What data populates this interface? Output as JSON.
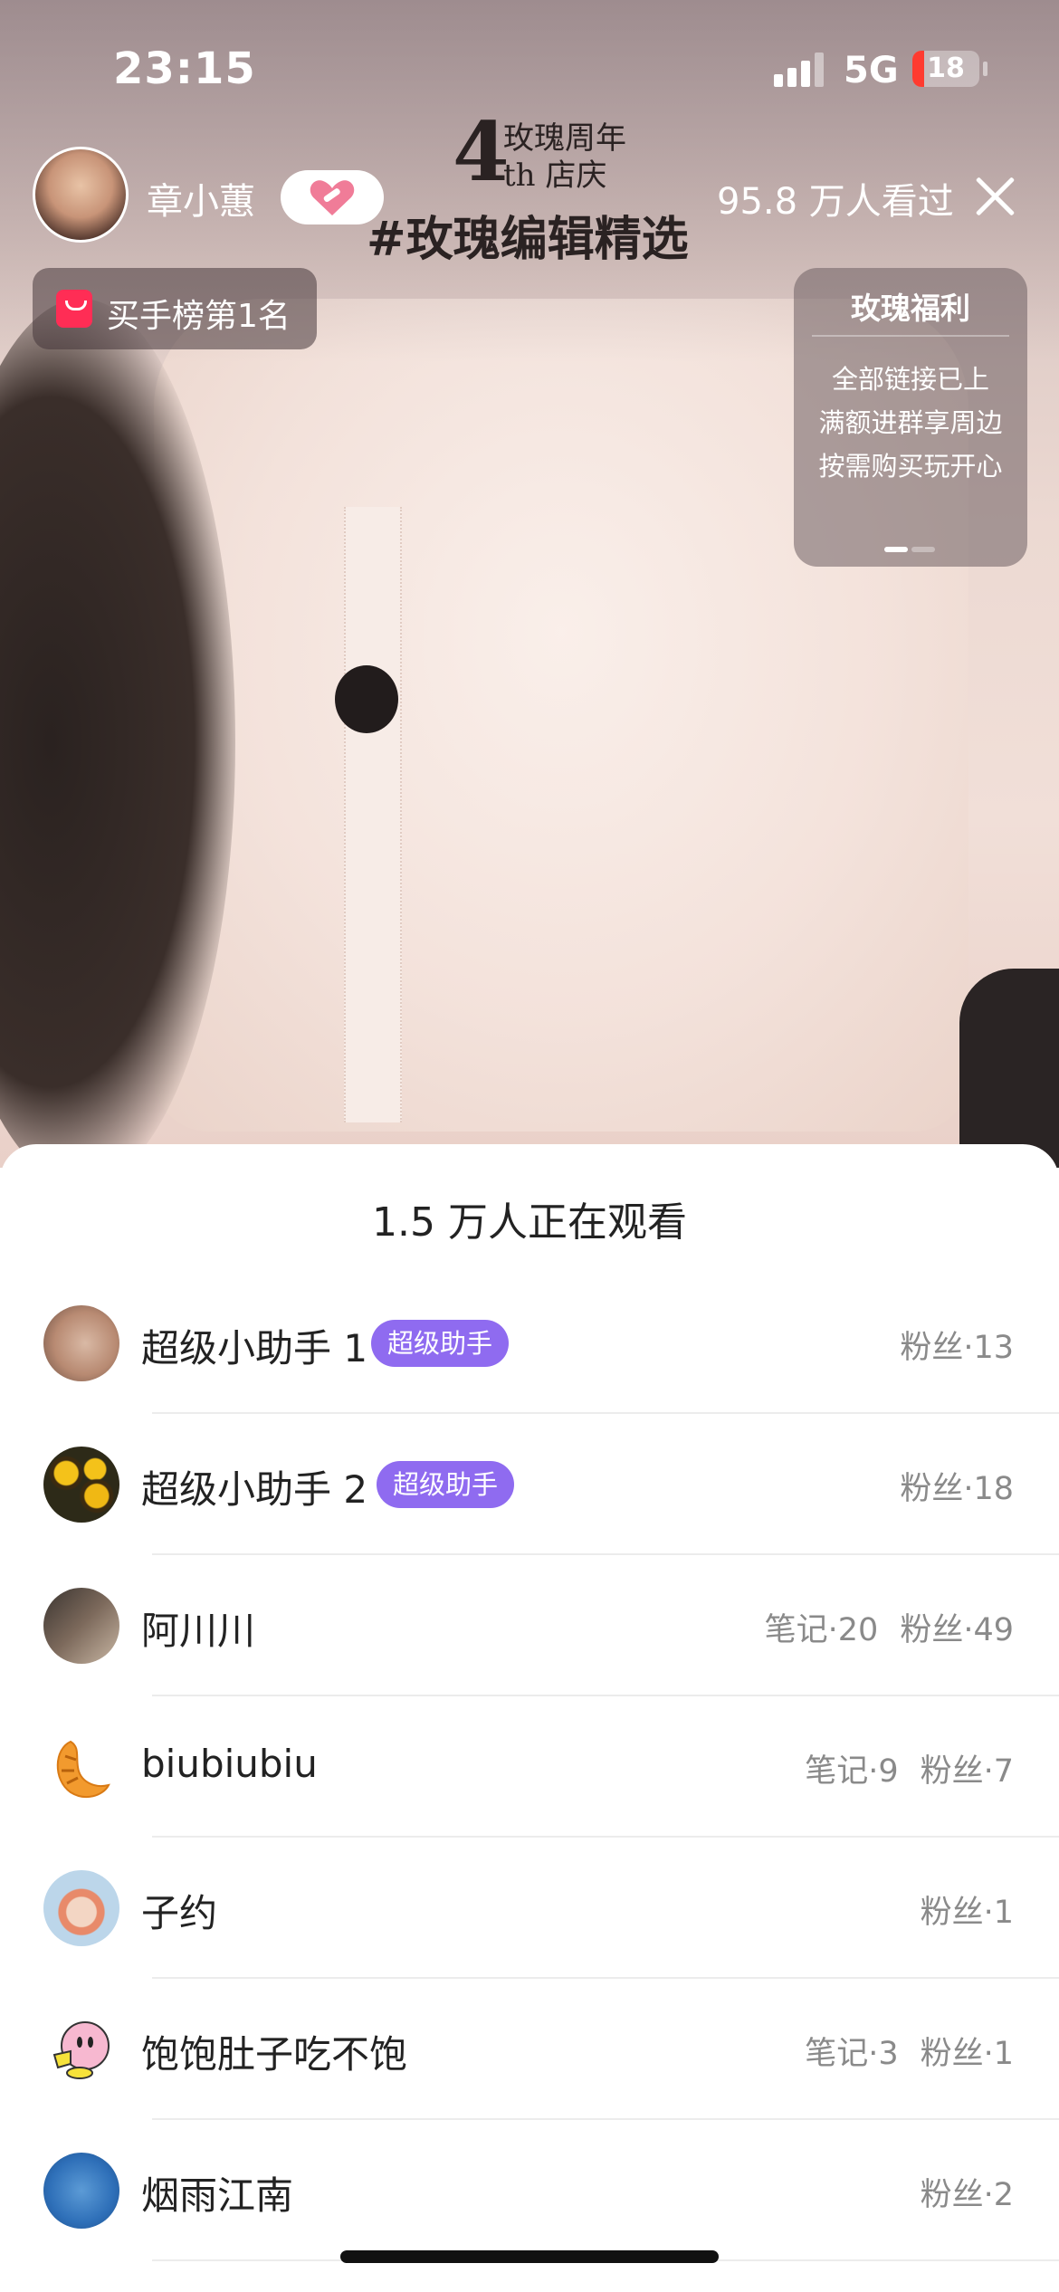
{
  "status_bar": {
    "time": "23:15",
    "network": "5G",
    "battery": "18",
    "battery_level": 0.18,
    "battery_color": "#ff3b30"
  },
  "host": {
    "name": "章小蕙",
    "viewed": "95.8 万人看过"
  },
  "banner": {
    "number": "4",
    "line1": "玫瑰周年",
    "line2": "th 店庆",
    "tag": "#玫瑰编辑精选"
  },
  "rank_badge": {
    "label": "买手榜第1名"
  },
  "welfare": {
    "title": "玫瑰福利",
    "lines": [
      "全部链接已上",
      "满额进群享周边",
      "按需购买玩开心"
    ]
  },
  "viewers_sheet": {
    "title": "1.5 万人正在观看",
    "accent": "#8f6bf0",
    "viewers": [
      {
        "name": "超级小助手 1",
        "badge": "超级助手",
        "notes": "",
        "fans": "粉丝·13"
      },
      {
        "name": "超级小助手 2",
        "badge": "超级助手",
        "notes": "",
        "fans": "粉丝·18"
      },
      {
        "name": "阿川川",
        "badge": "",
        "notes": "笔记·20",
        "fans": "粉丝·49"
      },
      {
        "name": "biubiubiu",
        "badge": "",
        "notes": "笔记·9",
        "fans": "粉丝·7"
      },
      {
        "name": "子约",
        "badge": "",
        "notes": "",
        "fans": "粉丝·1"
      },
      {
        "name": "饱饱肚子吃不饱",
        "badge": "",
        "notes": "笔记·3",
        "fans": "粉丝·1"
      },
      {
        "name": "烟雨江南",
        "badge": "",
        "notes": "",
        "fans": "粉丝·2"
      }
    ]
  }
}
